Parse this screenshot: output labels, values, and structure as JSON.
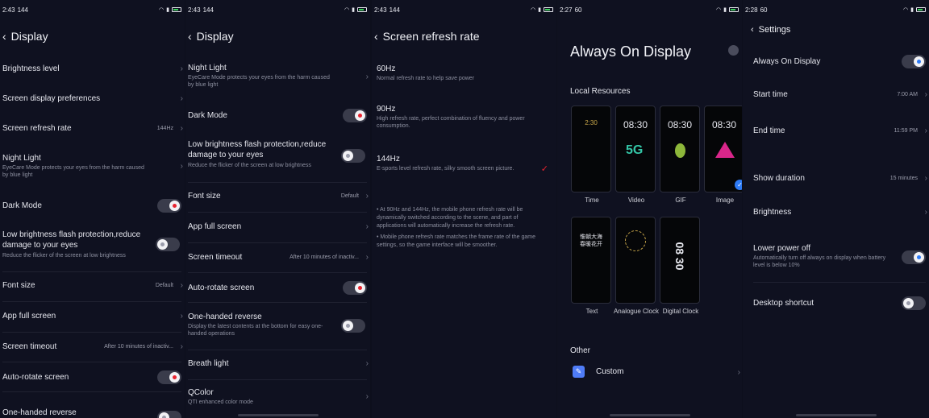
{
  "p1": {
    "time": "2:43",
    "net": "144",
    "title": "Display",
    "items": [
      {
        "label": "Brightness level"
      },
      {
        "label": "Screen display preferences"
      },
      {
        "label": "Screen refresh rate",
        "value": "144Hz"
      },
      {
        "label": "Night Light",
        "sub": "EyeCare Mode protects your eyes from the harm caused by blue light"
      },
      {
        "label": "Dark Mode"
      },
      {
        "label": "Low brightness flash protection,reduce damage to your eyes",
        "sub": "Reduce the flicker of the screen at low brightness"
      },
      {
        "label": "Font size",
        "value": "Default"
      },
      {
        "label": "App full screen"
      },
      {
        "label": "Screen timeout",
        "value": "After 10 minutes of inactiv..."
      },
      {
        "label": "Auto-rotate screen"
      },
      {
        "label": "One-handed reverse"
      }
    ]
  },
  "p2": {
    "time": "2:43",
    "net": "144",
    "title": "Display",
    "items": [
      {
        "label": "Night Light",
        "sub": "EyeCare Mode protects your eyes from the harm caused by blue light"
      },
      {
        "label": "Dark Mode"
      },
      {
        "label": "Low brightness flash protection,reduce damage to your eyes",
        "sub": "Reduce the flicker of the screen at low brightness"
      },
      {
        "label": "Font size",
        "value": "Default"
      },
      {
        "label": "App full screen"
      },
      {
        "label": "Screen timeout",
        "value": "After 10 minutes of inactiv..."
      },
      {
        "label": "Auto-rotate screen"
      },
      {
        "label": "One-handed reverse",
        "sub": "Display the latest contents at the bottom for easy one-handed operations"
      },
      {
        "label": "Breath light"
      },
      {
        "label": "QColor",
        "sub": "QTI enhanced color mode"
      }
    ]
  },
  "p3": {
    "time": "2:43",
    "net": "144",
    "title": "Screen refresh rate",
    "options": [
      {
        "label": "60Hz",
        "sub": "Normal refresh rate to help save power"
      },
      {
        "label": "90Hz",
        "sub": "High refresh rate, perfect combination of fluency and power consumption."
      },
      {
        "label": "144Hz",
        "sub": "E-sports level refresh rate, silky smooth screen picture."
      }
    ],
    "check": "✓",
    "note1": "• At 90Hz and 144Hz, the mobile phone refresh rate will be dynamically switched according to the scene, and part of applications will automatically increase the refresh rate.",
    "note2": "• Mobile phone refresh rate matches the frame rate of the game settings, so the game interface will be smoother."
  },
  "p4": {
    "time": "2:27",
    "net": "60",
    "title": "Always On Display",
    "local_resources": "Local Resources",
    "thumbs": [
      {
        "label": "Time",
        "text": "2:30"
      },
      {
        "label": "Video",
        "text": "08:30"
      },
      {
        "label": "GIF",
        "text": "08:30"
      },
      {
        "label": "Image",
        "text": "08:30"
      },
      {
        "label": "Text",
        "text": "惟朝大海 春暖花开"
      },
      {
        "label": "Analogue Clock",
        "text": ""
      },
      {
        "label": "Digital Clock",
        "text": "08 30"
      }
    ],
    "other": "Other",
    "custom": "Custom",
    "selected_mark": "✓"
  },
  "p5": {
    "time": "2:28",
    "net": "60",
    "title": "Settings",
    "items": [
      {
        "label": "Always On Display"
      },
      {
        "label": "Start time",
        "value": "7:00 AM"
      },
      {
        "label": "End time",
        "value": "11:59 PM"
      },
      {
        "label": "Show duration",
        "value": "15 minutes"
      },
      {
        "label": "Brightness"
      },
      {
        "label": "Lower power off",
        "sub": "Automatically turn off always on display when battery level is below 10%"
      },
      {
        "label": "Desktop shortcut"
      }
    ]
  },
  "icons": {
    "back": "‹",
    "chevron": "›",
    "pencil": "✎"
  }
}
